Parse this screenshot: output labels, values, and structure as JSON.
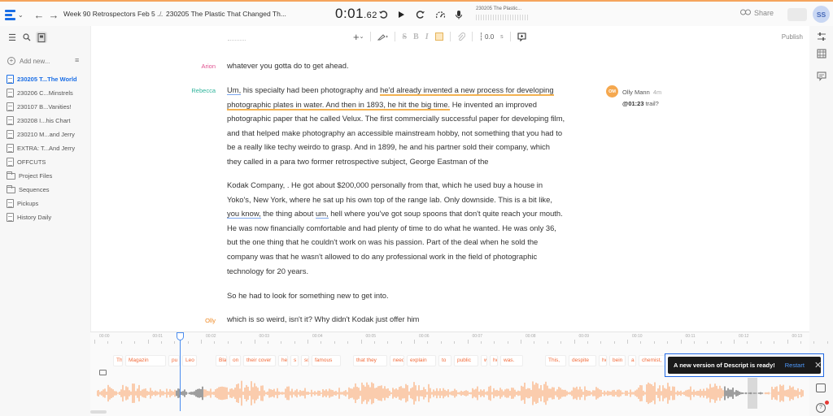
{
  "topbar": {
    "breadcrumb_project": "Week 90 Retrospectors Feb 5 ...",
    "breadcrumb_separator": "/",
    "breadcrumb_doc": "230205 The Plastic That Changed Th...",
    "timecode_main": "0:01",
    "timecode_frac": ".62",
    "mini_title": "230205 The Plastic...",
    "share_label": "Share",
    "avatar_initials": "SS"
  },
  "sidebar": {
    "add_new_label": "Add new...",
    "items": [
      {
        "label": "230205 T...The World",
        "type": "doc",
        "active": true
      },
      {
        "label": "230206 C...Minstrels",
        "type": "doc"
      },
      {
        "label": "230107 B...Vanities!",
        "type": "doc"
      },
      {
        "label": "230208 I...his Chart",
        "type": "doc"
      },
      {
        "label": "230210 M...and Jerry",
        "type": "doc"
      },
      {
        "label": "EXTRA: T...And Jerry",
        "type": "doc"
      },
      {
        "label": "OFFCUTS",
        "type": "doc"
      },
      {
        "label": "Project Files",
        "type": "folder"
      },
      {
        "label": "Sequences",
        "type": "folder"
      },
      {
        "label": "Pickups",
        "type": "doc"
      },
      {
        "label": "History Daily",
        "type": "doc"
      }
    ]
  },
  "toolbar": {
    "value_display": "0.0",
    "publish_label": "Publish"
  },
  "transcript": {
    "p1_speaker": "Arion",
    "p1_text": "whatever you gotta do to get ahead.",
    "p2_speaker": "Rebecca",
    "p2_a": "Um,",
    "p2_b": " his specialty had been photography and ",
    "p2_c": "he'd already invented a new process for developing photographic plates in water. And then in 1893, he hit the big time.",
    "p2_d": " He invented an improved photographic paper that he called Velux. The first commercially successful paper for developing film, and that helped make photography an accessible mainstream hobby, not something that you had to be a really like techy weirdo to grasp. And in 1899, he and his partner sold their company, which they called in a para two former retrospective subject, George Eastman of the",
    "p3_a": "Kodak Company, . He got about $200,000 personally from that, which he used buy a house in Yoko's, New York, where he sat up his own top of the range lab. Only downside. This is a bit like, ",
    "p3_b": "you know,",
    "p3_c": " the thing about ",
    "p3_d": "um,",
    "p3_e": " hell where you've got soup spoons that don't quite reach your mouth. He was now financially comfortable and had plenty of time to do what he wanted. He was only 36, but the one thing that he couldn't work on was his passion. Part of the deal when he sold the company was that he wasn't allowed to do any professional work in the field of photographic technology for 20 years.",
    "p4_text": "So he had to look for something new to get into.",
    "p5_speaker": "Olly",
    "p5_text": "which is so weird, isn't it? Why didn't Kodak just offer him"
  },
  "comment": {
    "avatar": "OM",
    "author": "Olly Mann",
    "age": "4m",
    "timestamp": "@01:23",
    "text": "trail?"
  },
  "timeline": {
    "ruler_labels": [
      "00:00",
      "00:01",
      "00:02",
      "00:03",
      "00:04",
      "00:05",
      "00:06",
      "00:07",
      "00:08",
      "00:09",
      "00:10",
      "00:11",
      "00:12",
      "00:13"
    ],
    "words": [
      "Th",
      "Magazin",
      "pu",
      "Leo",
      "Bla",
      "on",
      "their cover",
      "he",
      "s",
      "so",
      "famous",
      "that they",
      "need",
      "explain",
      "to",
      "public",
      "w",
      "he",
      "was.",
      "This,",
      "despite",
      "he",
      "bein",
      "a",
      "chemist,",
      "a"
    ]
  },
  "toast": {
    "message": "A new version of Descript is ready!",
    "action": "Restart"
  },
  "colors": {
    "accent": "#1a6ee6",
    "waveform": "#f9b98c",
    "word_text": "#f26b3a"
  }
}
